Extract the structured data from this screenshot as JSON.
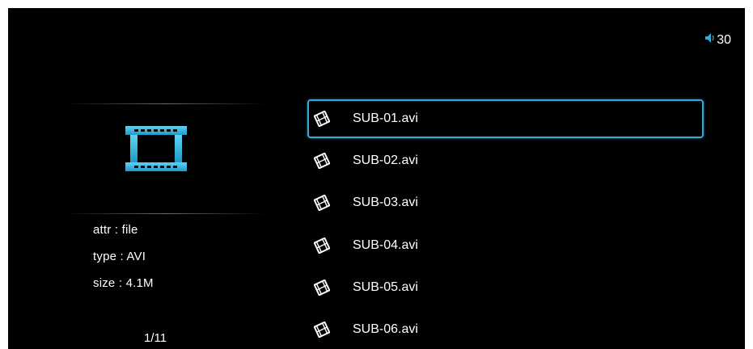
{
  "status": {
    "volume_icon": "speaker-icon",
    "volume_level": "30"
  },
  "preview": {
    "icon": "film-icon",
    "accent_color": "#2fb6de"
  },
  "file_info": {
    "attr": "attr : file",
    "type": "type : AVI",
    "size": "size : 4.1M"
  },
  "pagination": {
    "text": "1/11"
  },
  "files": [
    {
      "name": "SUB-01.avi",
      "icon": "film-file-icon",
      "selected": true
    },
    {
      "name": "SUB-02.avi",
      "icon": "film-file-icon",
      "selected": false
    },
    {
      "name": "SUB-03.avi",
      "icon": "film-file-icon",
      "selected": false
    },
    {
      "name": "SUB-04.avi",
      "icon": "film-file-icon",
      "selected": false
    },
    {
      "name": "SUB-05.avi",
      "icon": "film-file-icon",
      "selected": false
    },
    {
      "name": "SUB-06.avi",
      "icon": "film-file-icon",
      "selected": false
    }
  ],
  "colors": {
    "background": "#000000",
    "selection_border": "#3aa6d6",
    "text": "#ffffff"
  }
}
